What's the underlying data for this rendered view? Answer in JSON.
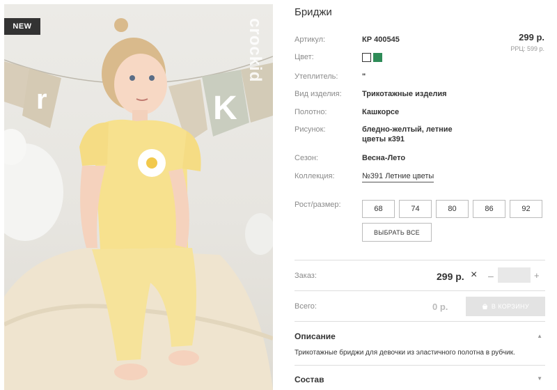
{
  "product": {
    "badge": "NEW",
    "title": "Бриджи",
    "price": "299 р.",
    "rrp": "РРЦ: 599 р.",
    "colors": [
      "#ffffff",
      "#2e8b57"
    ],
    "attributes": [
      {
        "label": "Артикул:",
        "value": "КР 400545"
      },
      {
        "label": "Цвет:",
        "value": ""
      },
      {
        "label": "Утеплитель:",
        "value": "\""
      },
      {
        "label": "Вид изделия:",
        "value": "Трикотажные изделия"
      },
      {
        "label": "Полотно:",
        "value": "Кашкорсе"
      },
      {
        "label": "Рисунок:",
        "value": "бледно-желтый, летние\nцветы к391"
      },
      {
        "label": "Сезон:",
        "value": "Весна-Лето"
      },
      {
        "label": "Коллекция:",
        "value": "№391 Летние цветы"
      }
    ],
    "size_label": "Рост/размер:",
    "sizes": [
      "68",
      "74",
      "80",
      "86",
      "92"
    ],
    "select_all": "ВЫБРАТЬ ВСЕ"
  },
  "order": {
    "label": "Заказ:",
    "price": "299 р.",
    "multiply": "×",
    "minus": "–",
    "plus": "+",
    "quantity": ""
  },
  "total": {
    "label": "Всего:",
    "value": "0 р.",
    "cart_button": "В КОРЗИНУ"
  },
  "sections": {
    "description_title": "Описание",
    "description_text": "Трикотажные бриджи для девочки из эластичного полотна в рубчик.",
    "composition_title": "Состав"
  },
  "icons": {
    "cart": "cart-icon",
    "description_toggle": "chevron-up-icon",
    "composition_toggle": "chevron-down-icon"
  }
}
